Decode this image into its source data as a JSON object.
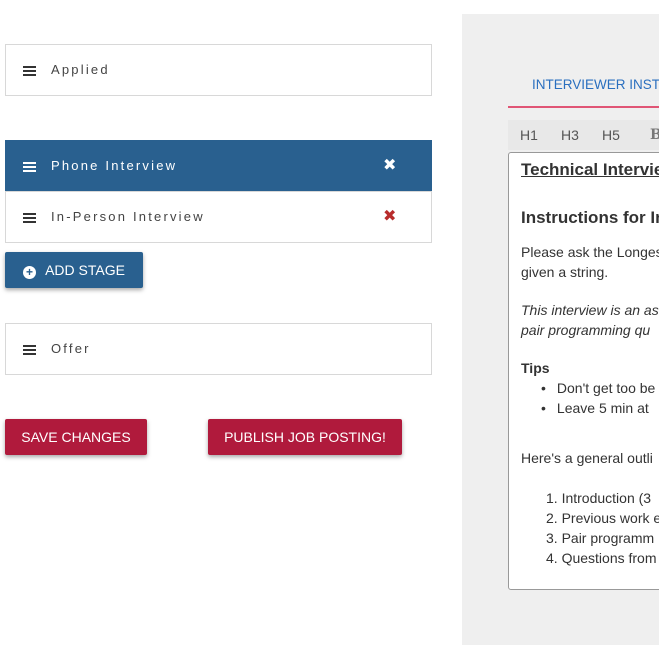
{
  "stages": [
    {
      "label": "Applied",
      "removable": false,
      "active": false
    },
    {
      "label": "Phone Interview",
      "removable": true,
      "active": true
    },
    {
      "label": "In-Person Interview",
      "removable": true,
      "active": false
    },
    {
      "label": "Offer",
      "removable": false,
      "active": false
    }
  ],
  "remove_glyph": "✖",
  "buttons": {
    "add_stage": "ADD STAGE",
    "add_icon": "+",
    "save": "SAVE CHANGES",
    "publish": "PUBLISH JOB POSTING!"
  },
  "panel": {
    "tab_label": "INTERVIEWER INSTR",
    "toolbar": [
      "H1",
      "H3",
      "H5",
      "B"
    ],
    "editor": {
      "title": "Technical Intervie",
      "heading": "Instructions for In",
      "para_line1": "Please ask the Longes",
      "para_line2": "given a string.",
      "italic_line1": "This interview is an as",
      "italic_line2": "pair programming qu",
      "tips_label": "Tips",
      "tips": [
        "Don't get too be",
        "Leave 5 min at"
      ],
      "outline_intro": "Here's a general outli",
      "outline": [
        "1. Introduction (3",
        "2. Previous work e",
        "3. Pair programm",
        "4. Questions from"
      ]
    }
  },
  "colors": {
    "primary": "#29608f",
    "danger": "#b01a3c",
    "remove_red": "#b82c2c",
    "tab_underline": "#e05575",
    "tab_text": "#2a6fbf"
  }
}
